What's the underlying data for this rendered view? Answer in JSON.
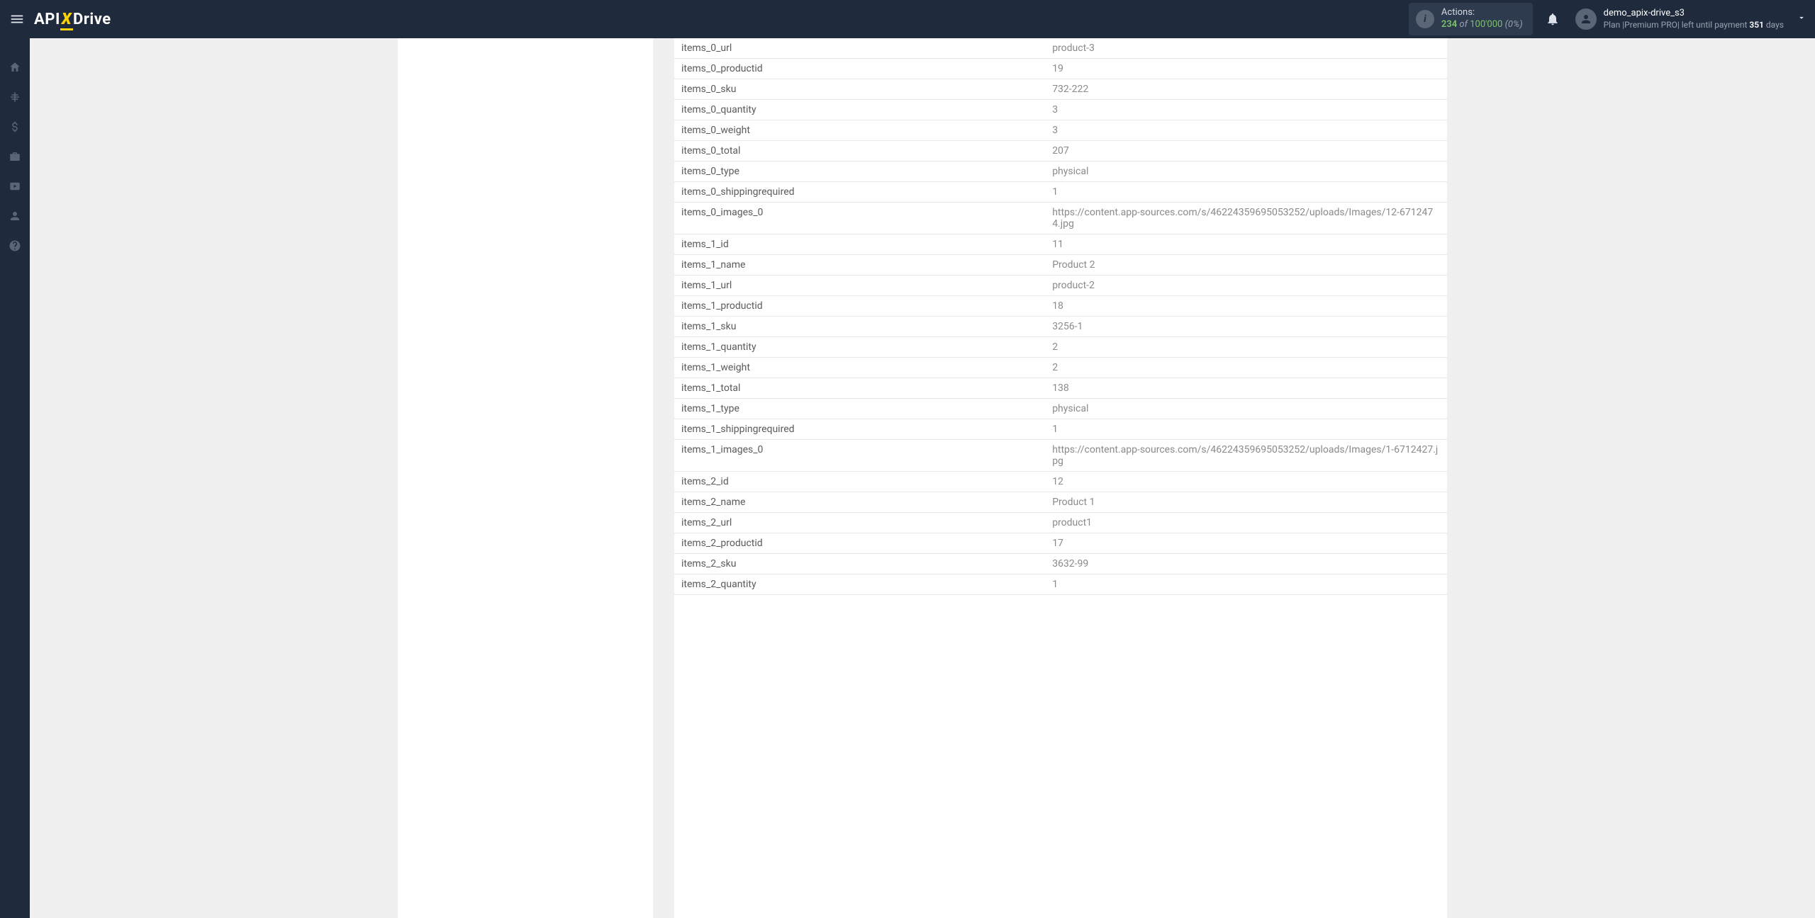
{
  "header": {
    "logo": {
      "api": "API",
      "x": "X",
      "drive": "Drive"
    },
    "actions": {
      "label": "Actions:",
      "count": "234",
      "of": "of",
      "total": "100'000",
      "pct": "(0%)"
    },
    "user": {
      "name": "demo_apix-drive_s3",
      "plan_prefix": "Plan |",
      "plan_name": "Premium PRO",
      "plan_mid": "| left until payment ",
      "days": "351",
      "plan_suffix": " days"
    }
  },
  "rows": [
    {
      "key": "items_0_url",
      "val": "product-3"
    },
    {
      "key": "items_0_productid",
      "val": "19"
    },
    {
      "key": "items_0_sku",
      "val": "732-222"
    },
    {
      "key": "items_0_quantity",
      "val": "3"
    },
    {
      "key": "items_0_weight",
      "val": "3"
    },
    {
      "key": "items_0_total",
      "val": "207"
    },
    {
      "key": "items_0_type",
      "val": "physical"
    },
    {
      "key": "items_0_shippingrequired",
      "val": "1"
    },
    {
      "key": "items_0_images_0",
      "val": "https://content.app-sources.com/s/46224359695053252/uploads/Images/12-6712474.jpg"
    },
    {
      "key": "items_1_id",
      "val": "11"
    },
    {
      "key": "items_1_name",
      "val": "Product 2"
    },
    {
      "key": "items_1_url",
      "val": "product-2"
    },
    {
      "key": "items_1_productid",
      "val": "18"
    },
    {
      "key": "items_1_sku",
      "val": "3256-1"
    },
    {
      "key": "items_1_quantity",
      "val": "2"
    },
    {
      "key": "items_1_weight",
      "val": "2"
    },
    {
      "key": "items_1_total",
      "val": "138"
    },
    {
      "key": "items_1_type",
      "val": "physical"
    },
    {
      "key": "items_1_shippingrequired",
      "val": "1"
    },
    {
      "key": "items_1_images_0",
      "val": "https://content.app-sources.com/s/46224359695053252/uploads/Images/1-6712427.jpg"
    },
    {
      "key": "items_2_id",
      "val": "12"
    },
    {
      "key": "items_2_name",
      "val": "Product 1"
    },
    {
      "key": "items_2_url",
      "val": "product1"
    },
    {
      "key": "items_2_productid",
      "val": "17"
    },
    {
      "key": "items_2_sku",
      "val": "3632-99"
    },
    {
      "key": "items_2_quantity",
      "val": "1"
    }
  ]
}
